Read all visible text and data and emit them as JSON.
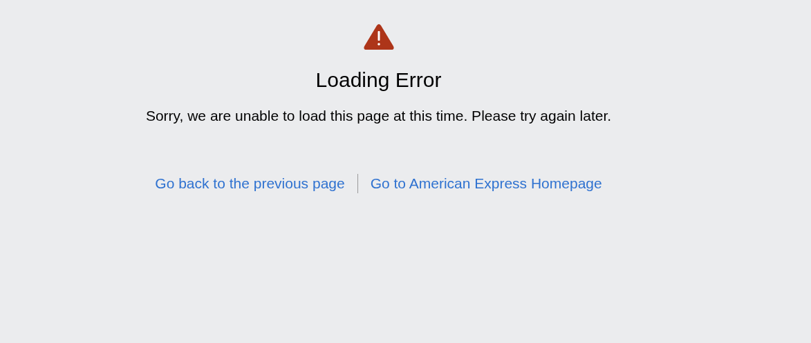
{
  "error": {
    "title": "Loading Error",
    "message": "Sorry, we are unable to load this page at this time. Please try again later."
  },
  "links": [
    {
      "label": "Go back to the previous page"
    },
    {
      "label": "Go to American Express Homepage"
    }
  ]
}
